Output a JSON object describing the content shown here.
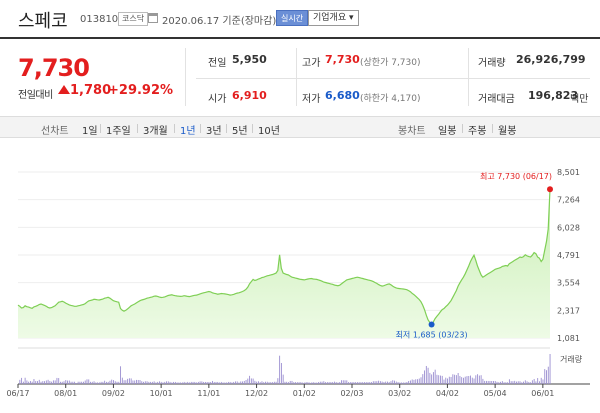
{
  "header": {
    "name": "스페코",
    "code": "013810",
    "market": "코스닥",
    "date": "2020.06.17  기준(장마감)",
    "realtime_label": "실시간",
    "company_info_label": "기업개요 ▾"
  },
  "summary": {
    "price": "7,730",
    "change_label": "전일대비",
    "change_amount": "1,780",
    "change_percent": "+29.92%"
  },
  "stats": {
    "prev_close_label": "전일",
    "prev_close": "5,950",
    "open_label": "시가",
    "open": "6,910",
    "high_label": "고가",
    "high": "7,730",
    "high_sub": "(상한가 7,730)",
    "low_label": "저가",
    "low": "6,680",
    "low_sub": "(하한가 4,170)",
    "volume_label": "거래량",
    "volume": "26,926,799",
    "amount_label": "거래대금",
    "amount": "196,823",
    "amount_unit": "백만"
  },
  "toolbar": {
    "line_chart_label": "선차트",
    "line_periods": [
      "1일",
      "1주일",
      "3개월",
      "1년",
      "3년",
      "5년",
      "10년"
    ],
    "active_period": "1년",
    "candle_label": "봉차트",
    "candle_periods": [
      "일봉",
      "주봉",
      "월봉"
    ]
  },
  "chart_data": {
    "type": "area",
    "high_annotation": "최고 7,730 (06/17)",
    "low_annotation": "최저 1,685 (03/23)",
    "y_ticks": [
      8501,
      7264,
      6028,
      4791,
      3554,
      2317,
      1081
    ],
    "y_tick_labels": [
      "8,501",
      "7,264",
      "6,028",
      "4,791",
      "3,554",
      "2,317",
      "1,081"
    ],
    "ylim": [
      1081,
      8501
    ],
    "x_ticks": [
      "06/17",
      "08/01",
      "09/02",
      "10/01",
      "11/01",
      "12/02",
      "01/02",
      "02/03",
      "03/02",
      "04/02",
      "05/04",
      "06/01"
    ],
    "volume_label": "거래량",
    "values": [
      2550,
      2500,
      2420,
      2440,
      2520,
      2480,
      2460,
      2430,
      2410,
      2470,
      2500,
      2530,
      2580,
      2600,
      2570,
      2540,
      2500,
      2450,
      2420,
      2440,
      2480,
      2520,
      2600,
      2680,
      2700,
      2720,
      2690,
      2640,
      2600,
      2560,
      2540,
      2520,
      2500,
      2500,
      2520,
      2540,
      2560,
      2580,
      2620,
      2680,
      2740,
      2760,
      2780,
      2810,
      2800,
      2790,
      2780,
      2800,
      2820,
      2860,
      2880,
      2900,
      2860,
      2800,
      2750,
      2720,
      2700,
      2680,
      2400,
      2320,
      2280,
      2320,
      2380,
      2450,
      2520,
      2560,
      2600,
      2650,
      2700,
      2750,
      2780,
      2800,
      2830,
      2860,
      2880,
      2900,
      2920,
      2950,
      2960,
      2940,
      2910,
      2890,
      2900,
      2920,
      2950,
      2980,
      3000,
      3010,
      2990,
      2970,
      2960,
      2950,
      2940,
      2950,
      2970,
      2960,
      2940,
      2930,
      2950,
      2970,
      2990,
      3000,
      3020,
      3050,
      3080,
      3100,
      3120,
      3140,
      3160,
      3140,
      3100,
      3080,
      3060,
      3040,
      3050,
      3070,
      3060,
      3050,
      3040,
      3020,
      3000,
      3010,
      3030,
      3060,
      3090,
      3100,
      3130,
      3160,
      3200,
      3260,
      3350,
      3500,
      3600,
      3700,
      3650,
      3680,
      3720,
      3740,
      3780,
      3800,
      3830,
      3860,
      3880,
      3900,
      3920,
      3950,
      3980,
      4100,
      4800,
      4200,
      3980,
      3950,
      3920,
      3900,
      3850,
      3800,
      3780,
      3760,
      3740,
      3720,
      3700,
      3690,
      3680,
      3700,
      3720,
      3730,
      3740,
      3720,
      3710,
      3700,
      3680,
      3650,
      3620,
      3580,
      3560,
      3540,
      3520,
      3500,
      3480,
      3450,
      3430,
      3420,
      3440,
      3500,
      3560,
      3620,
      3680,
      3700,
      3720,
      3740,
      3760,
      3780,
      3800,
      3780,
      3760,
      3740,
      3720,
      3700,
      3680,
      3660,
      3640,
      3600,
      3560,
      3520,
      3470,
      3430,
      3400,
      3420,
      3450,
      3480,
      3500,
      3460,
      3400,
      3350,
      3320,
      3300,
      3290,
      3280,
      3270,
      3260,
      3240,
      3200,
      3150,
      3080,
      3020,
      2950,
      2880,
      2800,
      2700,
      2550,
      2350,
      2100,
      1900,
      1780,
      1685,
      1800,
      1950,
      2050,
      2150,
      2250,
      2350,
      2400,
      2480,
      2550,
      2650,
      2750,
      2900,
      3050,
      3200,
      3400,
      3550,
      3680,
      3800,
      3950,
      4120,
      4300,
      4500,
      4650,
      4780,
      4550,
      4300,
      4100,
      3900,
      3800,
      3850,
      3900,
      3950,
      4000,
      4050,
      4100,
      4150,
      4180,
      4200,
      4230,
      4280,
      4300,
      4320,
      4300,
      4400,
      4450,
      4500,
      4560,
      4600,
      4650,
      4700,
      4680,
      4720,
      4800,
      4750,
      4720,
      4700,
      4780,
      4900,
      4850,
      4700,
      4650,
      4500,
      4600,
      5000,
      5400,
      5950,
      7730
    ]
  }
}
